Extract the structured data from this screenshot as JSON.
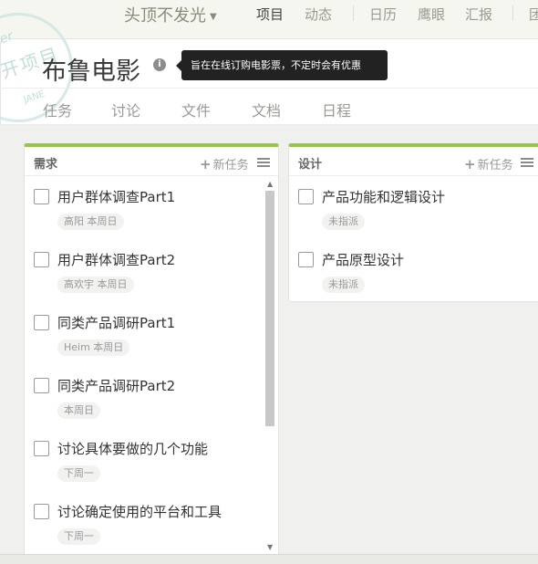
{
  "topnav": {
    "team": "头顶不发光",
    "items": [
      "项目",
      "动态",
      "日历",
      "鹰眼",
      "汇报",
      "团"
    ]
  },
  "stamp": {
    "line1": "ter",
    "line2": "开项目",
    "line3": "JANE"
  },
  "project": {
    "title": "布鲁电影",
    "info_icon": "info-icon",
    "tooltip": "旨在在线订购电影票，不定时会有优惠"
  },
  "tabs": [
    "任务",
    "讨论",
    "文件",
    "文档",
    "日程"
  ],
  "columns": [
    {
      "title": "需求",
      "add_label": "新任务",
      "tasks": [
        {
          "name": "用户群体调查Part1",
          "badge": "高阳 本周日"
        },
        {
          "name": "用户群体调查Part2",
          "badge": "高欢宇 本周日"
        },
        {
          "name": "同类产品调研Part1",
          "badge": "Heim 本周日"
        },
        {
          "name": "同类产品调研Part2",
          "badge": "本周日"
        },
        {
          "name": "讨论具体要做的几个功能",
          "badge": "下周一"
        },
        {
          "name": "讨论确定使用的平台和工具",
          "badge": "下周一"
        }
      ]
    },
    {
      "title": "设计",
      "add_label": "新任务",
      "tasks": [
        {
          "name": "产品功能和逻辑设计",
          "badge": "未指派"
        },
        {
          "name": "产品原型设计",
          "badge": "未指派"
        }
      ]
    }
  ],
  "colors": {
    "accent": "#92c846",
    "background": "#f6f6f1"
  }
}
